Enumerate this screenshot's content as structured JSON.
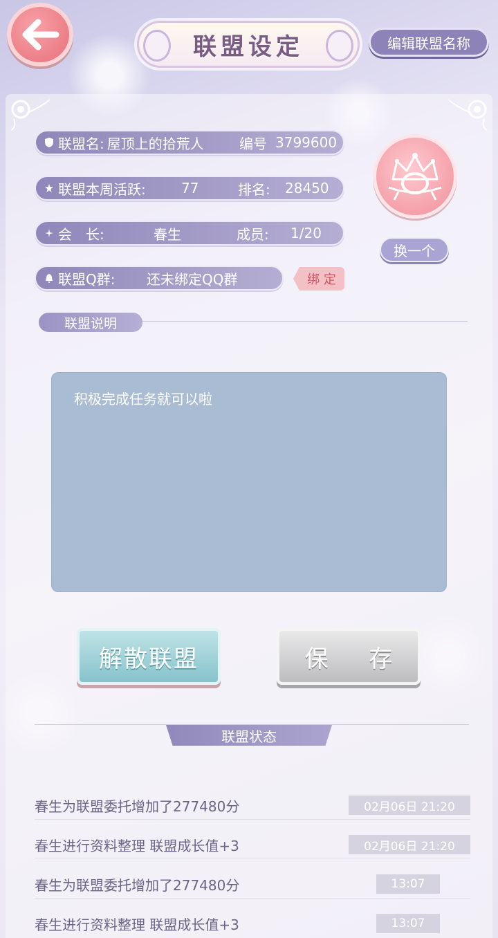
{
  "header": {
    "title": "联盟设定",
    "edit_name_label": "编辑联盟名称"
  },
  "info": {
    "name_label": "联盟名:",
    "name_value": "屋顶上的拾荒人",
    "id_label": "编号",
    "id_value": "3799600",
    "activity_label": "联盟本周活跃:",
    "activity_value": "77",
    "rank_label": "排名:",
    "rank_value": "28450",
    "leader_label": "会　长:",
    "leader_value": "春生",
    "members_label": "成员:",
    "members_value": "1/20",
    "qq_label": "联盟Q群:",
    "qq_value": "还未绑定QQ群",
    "bind_label": "绑 定"
  },
  "emblem": {
    "change_label": "换一个"
  },
  "description": {
    "section_label": "联盟说明",
    "text": "积极完成任务就可以啦"
  },
  "actions": {
    "disband_label": "解散联盟",
    "save_label": "保 存"
  },
  "status": {
    "section_label": "联盟状态",
    "logs": [
      {
        "text": "春生为联盟委托增加了277480分",
        "time": "02月06日 21:20"
      },
      {
        "text": "春生进行资料整理 联盟成长值+3",
        "time": "02月06日 21:20"
      },
      {
        "text": "春生为联盟委托增加了277480分",
        "time": "13:07"
      },
      {
        "text": "春生进行资料整理 联盟成长值+3",
        "time": "13:07"
      }
    ]
  },
  "colors": {
    "accent_purple": "#8f87b9",
    "back_pink": "#e8707a",
    "disband_teal": "#86c3cc",
    "save_gray": "#bdbdbf"
  },
  "icons": [
    "back-arrow-icon",
    "shield-icon",
    "star-icon",
    "sparkle-icon",
    "bell-icon",
    "emblem-crown-icon"
  ]
}
